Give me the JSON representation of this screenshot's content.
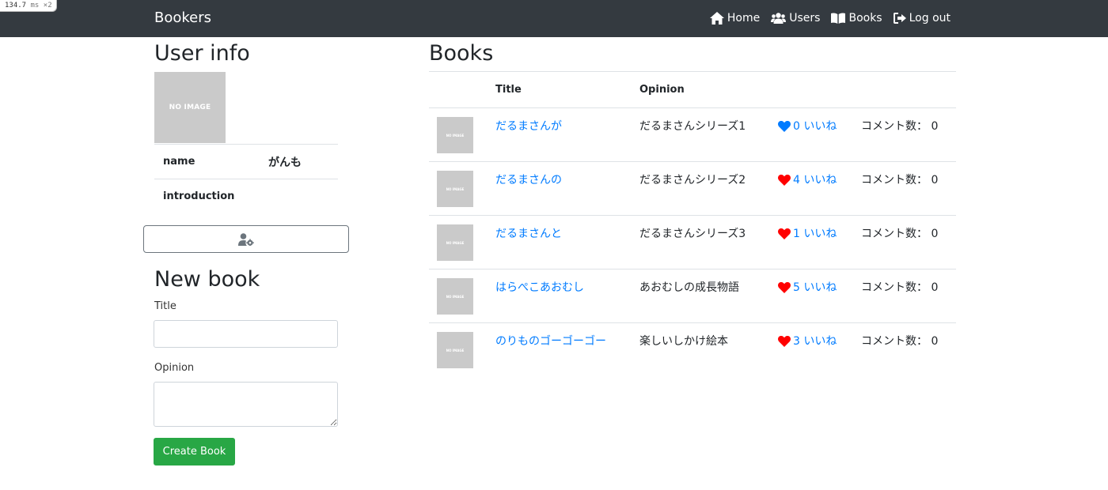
{
  "perf": {
    "value": "134.7",
    "unit": "ms",
    "multiplier": "×2"
  },
  "navbar": {
    "brand": "Bookers",
    "links": [
      {
        "label": "Home",
        "icon": "home-icon"
      },
      {
        "label": "Users",
        "icon": "users-icon"
      },
      {
        "label": "Books",
        "icon": "book-open-icon"
      },
      {
        "label": "Log out",
        "icon": "sign-out-icon"
      }
    ]
  },
  "user_info": {
    "title": "User info",
    "image_text": "NO IMAGE",
    "name_label": "name",
    "name_value": "がんも",
    "introduction_label": "introduction",
    "introduction_value": "",
    "edit_icon": "user-cog-icon"
  },
  "new_book": {
    "title": "New book",
    "title_label": "Title",
    "title_value": "",
    "opinion_label": "Opinion",
    "opinion_value": "",
    "submit_label": "Create Book"
  },
  "books": {
    "title": "Books",
    "headers": [
      "",
      "Title",
      "Opinion",
      "",
      ""
    ],
    "thumb_text": "NO IMAGE",
    "rows": [
      {
        "title": "だるまさんが",
        "opinion": "だるまさんシリーズ1",
        "likes": "0 いいね",
        "liked": false,
        "comments": "コメント数： 0"
      },
      {
        "title": "だるまさんの",
        "opinion": "だるまさんシリーズ2",
        "likes": "4 いいね",
        "liked": true,
        "comments": "コメント数： 0"
      },
      {
        "title": "だるまさんと",
        "opinion": "だるまさんシリーズ3",
        "likes": "1 いいね",
        "liked": true,
        "comments": "コメント数： 0"
      },
      {
        "title": "はらぺこあおむし",
        "opinion": "あおむしの成長物語",
        "likes": "5 いいね",
        "liked": true,
        "comments": "コメント数： 0"
      },
      {
        "title": "のりものゴーゴーゴー",
        "opinion": "楽しいしかけ絵本",
        "likes": "3 いいね",
        "liked": true,
        "comments": "コメント数： 0"
      }
    ]
  },
  "colors": {
    "navbar_bg": "#343a40",
    "link": "#007bff",
    "heart_liked": "#ff0000",
    "heart_unliked": "#007bff",
    "create_button": "#28a745"
  }
}
